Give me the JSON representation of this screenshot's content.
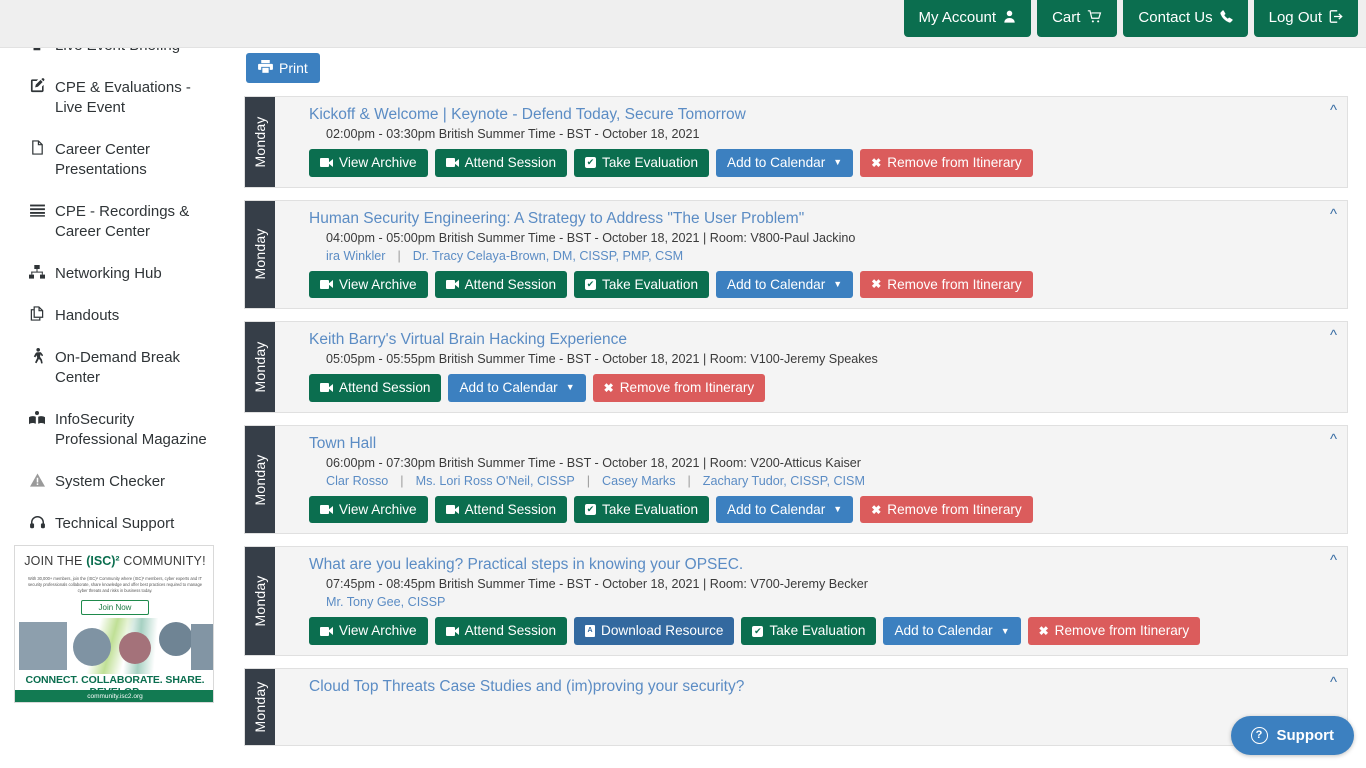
{
  "topnav": {
    "buttons": [
      {
        "label": "My Account",
        "icon": "user-icon",
        "glyph": "\u0000"
      },
      {
        "label": "Cart",
        "icon": "cart-icon",
        "glyph": "\u0000"
      },
      {
        "label": "Contact Us",
        "icon": "phone-icon",
        "glyph": "\u0000"
      },
      {
        "label": "Log Out",
        "icon": "logout-icon",
        "glyph": "\u0000"
      }
    ]
  },
  "sidebar": {
    "items": [
      {
        "label": "CPE & Evaluations - Live Event",
        "icon": "edit-square-icon",
        "glyph": "✎"
      },
      {
        "label": "Career Center Presentations",
        "icon": "file-icon",
        "glyph": "⎕"
      },
      {
        "label": "CPE - Recordings & Career Center",
        "icon": "list-icon",
        "glyph": "☰"
      },
      {
        "label": "Networking Hub",
        "icon": "sitemap-icon",
        "glyph": "⛓"
      },
      {
        "label": "Handouts",
        "icon": "copy-icon",
        "glyph": "❐"
      },
      {
        "label": "On-Demand Break Center",
        "icon": "walking-icon",
        "glyph": "Ὣ6"
      },
      {
        "label": "InfoSecurity Professional Magazine",
        "icon": "book-reader-icon",
        "glyph": "■"
      },
      {
        "label": "System Checker",
        "icon": "warning-icon",
        "glyph": "⚠"
      },
      {
        "label": "Technical Support",
        "icon": "headset-icon",
        "glyph": "☺"
      }
    ],
    "banner": {
      "headline_pre": "JOIN THE ",
      "headline_brand": "(ISC)²",
      "headline_post": " COMMUNITY!",
      "body": "With 30,000+ members, join the (ISC)² Community where (ISC)² members, cyber experts and IT security professionals collaborate, share knowledge and offer best practices required to manage cyber threats and risks in business today.",
      "cta": "Join Now",
      "tagline": "CONNECT. COLLABORATE. SHARE. DEVELOP.",
      "url": "community.isc2.org"
    }
  },
  "toolbar": {
    "print_label": "Print",
    "print_icon": "printer-icon"
  },
  "sessions": [
    {
      "day": "Monday",
      "title": "Kickoff & Welcome | Keynote - Defend Today, Secure Tomorrow",
      "meta": "02:00pm - 03:30pm British Summer Time - BST - October 18, 2021",
      "speakers": [],
      "buttons": [
        {
          "label": "View Archive",
          "style": "green",
          "icon": "video-icon"
        },
        {
          "label": "Attend Session",
          "style": "green",
          "icon": "video-icon"
        },
        {
          "label": "Take Evaluation",
          "style": "green",
          "icon": "checkbox-icon"
        },
        {
          "label": "Add to Calendar",
          "style": "blue",
          "icon": "caret-down-icon"
        },
        {
          "label": "Remove from Itinerary",
          "style": "red",
          "icon": "times-icon"
        }
      ]
    },
    {
      "day": "Monday",
      "title": "Human Security Engineering: A Strategy to Address \"The User Problem\"",
      "meta": "04:00pm - 05:00pm British Summer Time - BST - October 18, 2021 | Room: V800-Paul Jackino",
      "speakers": [
        "ira Winkler",
        "Dr. Tracy Celaya-Brown, DM, CISSP, PMP, CSM"
      ],
      "buttons": [
        {
          "label": "View Archive",
          "style": "green",
          "icon": "video-icon"
        },
        {
          "label": "Attend Session",
          "style": "green",
          "icon": "video-icon"
        },
        {
          "label": "Take Evaluation",
          "style": "green",
          "icon": "checkbox-icon"
        },
        {
          "label": "Add to Calendar",
          "style": "blue",
          "icon": "caret-down-icon"
        },
        {
          "label": "Remove from Itinerary",
          "style": "red",
          "icon": "times-icon"
        }
      ]
    },
    {
      "day": "Monday",
      "title": "Keith Barry's Virtual Brain Hacking Experience",
      "meta": "05:05pm - 05:55pm British Summer Time - BST - October 18, 2021 | Room: V100-Jeremy Speakes",
      "speakers": [],
      "buttons": [
        {
          "label": "Attend Session",
          "style": "green",
          "icon": "video-icon"
        },
        {
          "label": "Add to Calendar",
          "style": "blue",
          "icon": "caret-down-icon"
        },
        {
          "label": "Remove from Itinerary",
          "style": "red",
          "icon": "times-icon"
        }
      ]
    },
    {
      "day": "Monday",
      "title": "Town Hall",
      "meta": "06:00pm - 07:30pm British Summer Time - BST - October 18, 2021 | Room: V200-Atticus Kaiser",
      "speakers": [
        "Clar Rosso",
        "Ms. Lori Ross O'Neil, CISSP",
        "Casey Marks",
        "Zachary Tudor, CISSP, CISM"
      ],
      "buttons": [
        {
          "label": "View Archive",
          "style": "green",
          "icon": "video-icon"
        },
        {
          "label": "Attend Session",
          "style": "green",
          "icon": "video-icon"
        },
        {
          "label": "Take Evaluation",
          "style": "green",
          "icon": "checkbox-icon"
        },
        {
          "label": "Add to Calendar",
          "style": "blue",
          "icon": "caret-down-icon"
        },
        {
          "label": "Remove from Itinerary",
          "style": "red",
          "icon": "times-icon"
        }
      ]
    },
    {
      "day": "Monday",
      "title": "What are you leaking? Practical steps in knowing your OPSEC.",
      "meta": "07:45pm - 08:45pm British Summer Time - BST - October 18, 2021 | Room: V700-Jeremy Becker",
      "speakers": [
        "Mr. Tony Gee, CISSP"
      ],
      "buttons": [
        {
          "label": "View Archive",
          "style": "green",
          "icon": "video-icon"
        },
        {
          "label": "Attend Session",
          "style": "green",
          "icon": "video-icon"
        },
        {
          "label": "Download Resource",
          "style": "dblue",
          "icon": "pdf-icon"
        },
        {
          "label": "Take Evaluation",
          "style": "green",
          "icon": "checkbox-icon"
        },
        {
          "label": "Add to Calendar",
          "style": "blue",
          "icon": "caret-down-icon"
        },
        {
          "label": "Remove from Itinerary",
          "style": "red",
          "icon": "times-icon"
        }
      ]
    },
    {
      "day": "Monday",
      "title": "Cloud Top Threats Case Studies and (im)proving your security?",
      "meta": "",
      "speakers": [],
      "buttons": []
    }
  ],
  "support": {
    "label": "Support",
    "icon": "question-circle-icon"
  }
}
